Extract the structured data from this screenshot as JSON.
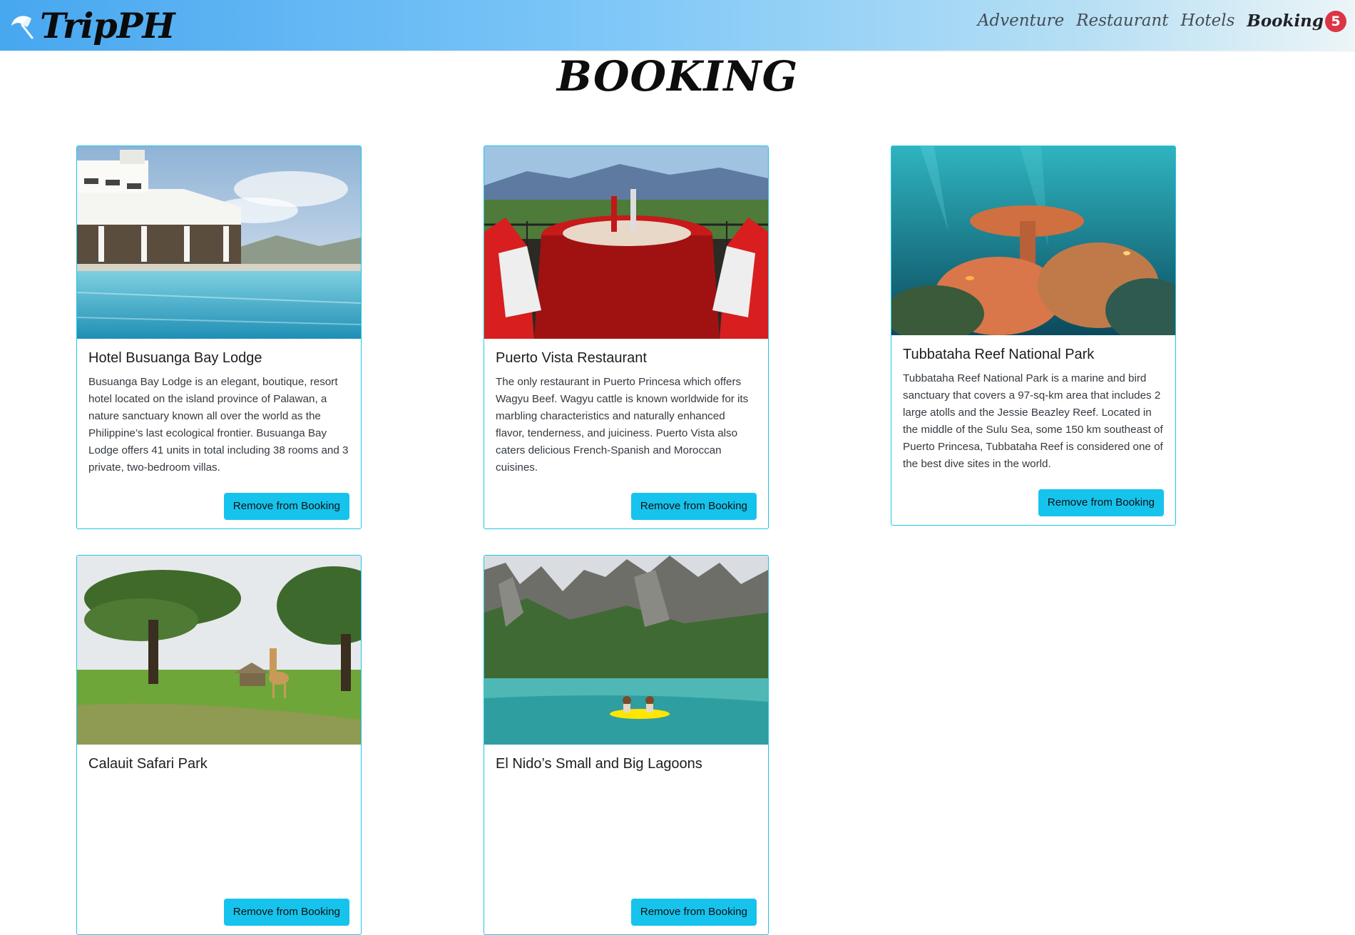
{
  "brand": {
    "name": "TripPH",
    "logo_icon": "beach-umbrella-icon"
  },
  "nav": {
    "items": [
      {
        "label": "Adventure"
      },
      {
        "label": "Restaurant"
      },
      {
        "label": "Hotels"
      }
    ],
    "booking": {
      "label": "Booking",
      "count": "5"
    }
  },
  "page": {
    "title": "BOOKING"
  },
  "colors": {
    "accent": "#16c3ec",
    "badge": "#dc3545",
    "card_border": "#20c5e8"
  },
  "cards": [
    {
      "title": "Hotel Busuanga Bay Lodge",
      "description": "Busuanga Bay Lodge is an elegant, boutique, resort hotel located on the island province of Palawan, a nature sanctuary known all over the world as the Philippine’s last ecological frontier. Busuanga Bay Lodge offers 41 units in total including 38 rooms and 3 private, two-bedroom villas.",
      "button": "Remove from Booking"
    },
    {
      "title": "Puerto Vista Restaurant",
      "description": "The only restaurant in Puerto Princesa which offers Wagyu Beef. Wagyu cattle is known worldwide for its marbling characteristics and naturally enhanced flavor, tenderness, and juiciness. Puerto Vista also caters delicious French-Spanish and Moroccan cuisines.",
      "button": "Remove from Booking"
    },
    {
      "title": "Tubbataha Reef National Park",
      "description": "Tubbataha Reef National Park is a marine and bird sanctuary that covers a 97-sq-km area that includes 2 large atolls and the Jessie Beazley Reef. Located in the middle of the Sulu Sea, some 150 km southeast of Puerto Princesa, Tubbataha Reef is considered one of the best dive sites in the world.",
      "button": "Remove from Booking"
    },
    {
      "title": "Calauit Safari Park",
      "description": "",
      "button": "Remove from Booking"
    },
    {
      "title": "El Nido’s Small and Big Lagoons",
      "description": "",
      "button": "Remove from Booking"
    }
  ]
}
